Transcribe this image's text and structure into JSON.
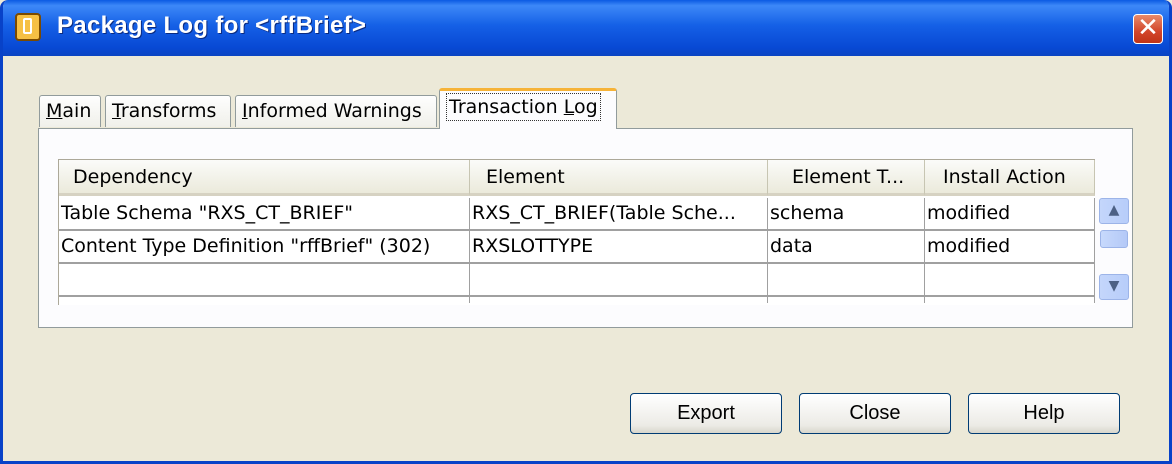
{
  "window": {
    "title": "Package Log for <rffBrief>"
  },
  "tabs": [
    {
      "label": "Main",
      "mnemonic": "M",
      "rest": "ain"
    },
    {
      "label": "Transforms",
      "mnemonic": "T",
      "rest": "ransforms"
    },
    {
      "label": "Informed Warnings",
      "mnemonic": "I",
      "rest": "nformed Warnings"
    },
    {
      "label": "Transaction Log",
      "pre": "Transaction ",
      "mnemonic": "L",
      "rest": "og",
      "active": true
    }
  ],
  "table": {
    "columns": [
      "Dependency",
      "Element",
      "Element T...",
      "Install Action"
    ],
    "rows": [
      [
        "Table Schema \"RXS_CT_BRIEF\"",
        "RXS_CT_BRIEF(Table Sche...",
        "schema",
        "modified"
      ],
      [
        "Content Type Definition \"rffBrief\" (302)",
        "RXSLOTTYPE",
        "data",
        "modified"
      ],
      [
        "",
        "",
        "",
        ""
      ],
      [
        "",
        "",
        "",
        ""
      ]
    ]
  },
  "buttons": {
    "export": "Export",
    "close": "Close",
    "help": "Help"
  },
  "icons": {
    "title": "package-log-icon",
    "close": "close-icon",
    "scroll_up": "scroll-up-arrow-icon",
    "scroll_down": "scroll-down-arrow-icon"
  },
  "colors": {
    "titlebar": "#0a5ae3",
    "window_bg": "#ece9d8",
    "active_tab_accent": "#f6b338"
  }
}
